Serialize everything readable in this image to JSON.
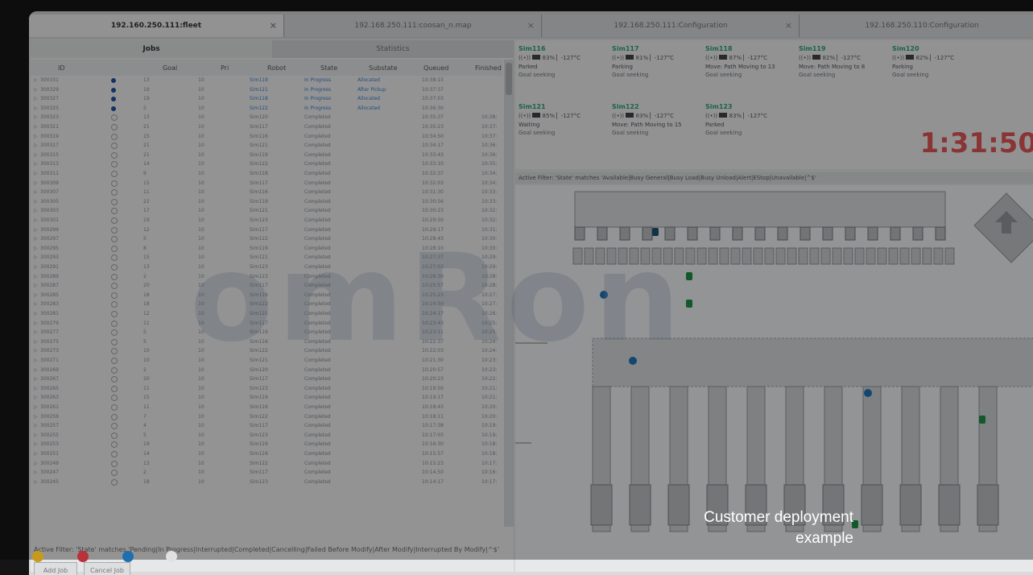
{
  "tabs": [
    {
      "label": "192.160.250.111:fleet",
      "active": true
    },
    {
      "label": "192.168.250.111:coosan_n.map",
      "active": false
    },
    {
      "label": "192.168.250.111:Configuration",
      "active": false
    },
    {
      "label": "192.168.250.110:Configuration",
      "active": false
    }
  ],
  "jobs_panel": {
    "tab_jobs": "Jobs",
    "tab_statistics": "Statistics",
    "columns": [
      "ID",
      "Goal",
      "Pri",
      "Robot",
      "State",
      "Substate",
      "Queued",
      "Finished"
    ],
    "rows": [
      {
        "id": "300331",
        "goal": "13",
        "pri": "10",
        "robot": "Sim119",
        "state": "In Progress",
        "substate": "Allocated",
        "queued": "10:38:15",
        "finished": ""
      },
      {
        "id": "300329",
        "goal": "19",
        "pri": "10",
        "robot": "Sim121",
        "state": "In Progress",
        "substate": "After Pickup",
        "queued": "10:37:37",
        "finished": ""
      },
      {
        "id": "300327",
        "goal": "19",
        "pri": "10",
        "robot": "Sim118",
        "state": "In Progress",
        "substate": "Allocated",
        "queued": "10:37:03",
        "finished": ""
      },
      {
        "id": "300325",
        "goal": "5",
        "pri": "10",
        "robot": "Sim122",
        "state": "In Progress",
        "substate": "Allocated",
        "queued": "10:36:30",
        "finished": ""
      },
      {
        "id": "300323",
        "goal": "13",
        "pri": "10",
        "robot": "Sim120",
        "state": "Completed",
        "substate": "",
        "queued": "10:35:37",
        "finished": "10:38:"
      },
      {
        "id": "300321",
        "goal": "21",
        "pri": "10",
        "robot": "Sim117",
        "state": "Completed",
        "substate": "",
        "queued": "10:35:23",
        "finished": "10:37:"
      },
      {
        "id": "300319",
        "goal": "15",
        "pri": "10",
        "robot": "Sim116",
        "state": "Completed",
        "substate": "",
        "queued": "10:34:50",
        "finished": "10:37:"
      },
      {
        "id": "300317",
        "goal": "21",
        "pri": "10",
        "robot": "Sim121",
        "state": "Completed",
        "substate": "",
        "queued": "10:34:17",
        "finished": "10:36:"
      },
      {
        "id": "300315",
        "goal": "21",
        "pri": "10",
        "robot": "Sim119",
        "state": "Completed",
        "substate": "",
        "queued": "10:33:43",
        "finished": "10:36:"
      },
      {
        "id": "300313",
        "goal": "14",
        "pri": "10",
        "robot": "Sim122",
        "state": "Completed",
        "substate": "",
        "queued": "10:33:10",
        "finished": "10:35:"
      },
      {
        "id": "300311",
        "goal": "9",
        "pri": "10",
        "robot": "Sim118",
        "state": "Completed",
        "substate": "",
        "queued": "10:32:37",
        "finished": "10:34:"
      },
      {
        "id": "300309",
        "goal": "15",
        "pri": "10",
        "robot": "Sim117",
        "state": "Completed",
        "substate": "",
        "queued": "10:32:03",
        "finished": "10:34:"
      },
      {
        "id": "300307",
        "goal": "11",
        "pri": "10",
        "robot": "Sim116",
        "state": "Completed",
        "substate": "",
        "queued": "10:31:30",
        "finished": "10:33:"
      },
      {
        "id": "300305",
        "goal": "22",
        "pri": "10",
        "robot": "Sim119",
        "state": "Completed",
        "substate": "",
        "queued": "10:30:56",
        "finished": "10:33:"
      },
      {
        "id": "300303",
        "goal": "17",
        "pri": "10",
        "robot": "Sim121",
        "state": "Completed",
        "substate": "",
        "queued": "10:30:23",
        "finished": "10:32:"
      },
      {
        "id": "300301",
        "goal": "19",
        "pri": "10",
        "robot": "Sim123",
        "state": "Completed",
        "substate": "",
        "queued": "10:29:50",
        "finished": "10:32:"
      },
      {
        "id": "300299",
        "goal": "12",
        "pri": "10",
        "robot": "Sim117",
        "state": "Completed",
        "substate": "",
        "queued": "10:29:17",
        "finished": "10:31:"
      },
      {
        "id": "300297",
        "goal": "5",
        "pri": "10",
        "robot": "Sim122",
        "state": "Completed",
        "substate": "",
        "queued": "10:28:43",
        "finished": "10:30:"
      },
      {
        "id": "300295",
        "goal": "8",
        "pri": "10",
        "robot": "Sim119",
        "state": "Completed",
        "substate": "",
        "queued": "10:28:10",
        "finished": "10:30:"
      },
      {
        "id": "300293",
        "goal": "15",
        "pri": "10",
        "robot": "Sim121",
        "state": "Completed",
        "substate": "",
        "queued": "10:27:37",
        "finished": "10:29:"
      },
      {
        "id": "300291",
        "goal": "13",
        "pri": "10",
        "robot": "Sim123",
        "state": "Completed",
        "substate": "",
        "queued": "10:27:03",
        "finished": "10:29:"
      },
      {
        "id": "300289",
        "goal": "2",
        "pri": "10",
        "robot": "Sim123",
        "state": "Completed",
        "substate": "",
        "queued": "10:26:30",
        "finished": "10:28:"
      },
      {
        "id": "300287",
        "goal": "20",
        "pri": "10",
        "robot": "Sim117",
        "state": "Completed",
        "substate": "",
        "queued": "10:25:57",
        "finished": "10:28:"
      },
      {
        "id": "300285",
        "goal": "18",
        "pri": "10",
        "robot": "Sim116",
        "state": "Completed",
        "substate": "",
        "queued": "10:25:23",
        "finished": "10:27:"
      },
      {
        "id": "300283",
        "goal": "18",
        "pri": "10",
        "robot": "Sim122",
        "state": "Completed",
        "substate": "",
        "queued": "10:24:50",
        "finished": "10:27:"
      },
      {
        "id": "300281",
        "goal": "12",
        "pri": "10",
        "robot": "Sim121",
        "state": "Completed",
        "substate": "",
        "queued": "10:24:17",
        "finished": "10:26:"
      },
      {
        "id": "300279",
        "goal": "11",
        "pri": "10",
        "robot": "Sim117",
        "state": "Completed",
        "substate": "",
        "queued": "10:23:43",
        "finished": "10:25:"
      },
      {
        "id": "300277",
        "goal": "5",
        "pri": "10",
        "robot": "Sim119",
        "state": "Completed",
        "substate": "",
        "queued": "10:23:11",
        "finished": "10:25:"
      },
      {
        "id": "300275",
        "goal": "5",
        "pri": "10",
        "robot": "Sim116",
        "state": "Completed",
        "substate": "",
        "queued": "10:22:37",
        "finished": "10:24:"
      },
      {
        "id": "300273",
        "goal": "10",
        "pri": "10",
        "robot": "Sim122",
        "state": "Completed",
        "substate": "",
        "queued": "10:22:03",
        "finished": "10:24:"
      },
      {
        "id": "300271",
        "goal": "10",
        "pri": "10",
        "robot": "Sim121",
        "state": "Completed",
        "substate": "",
        "queued": "10:21:30",
        "finished": "10:23:"
      },
      {
        "id": "300269",
        "goal": "2",
        "pri": "10",
        "robot": "Sim120",
        "state": "Completed",
        "substate": "",
        "queued": "10:20:57",
        "finished": "10:23:"
      },
      {
        "id": "300267",
        "goal": "20",
        "pri": "10",
        "robot": "Sim117",
        "state": "Completed",
        "substate": "",
        "queued": "10:20:23",
        "finished": "10:22:"
      },
      {
        "id": "300265",
        "goal": "11",
        "pri": "10",
        "robot": "Sim123",
        "state": "Completed",
        "substate": "",
        "queued": "10:19:50",
        "finished": "10:21:"
      },
      {
        "id": "300263",
        "goal": "15",
        "pri": "10",
        "robot": "Sim119",
        "state": "Completed",
        "substate": "",
        "queued": "10:19:17",
        "finished": "10:21:"
      },
      {
        "id": "300261",
        "goal": "11",
        "pri": "10",
        "robot": "Sim116",
        "state": "Completed",
        "substate": "",
        "queued": "10:18:43",
        "finished": "10:20:"
      },
      {
        "id": "300259",
        "goal": "7",
        "pri": "10",
        "robot": "Sim122",
        "state": "Completed",
        "substate": "",
        "queued": "10:18:11",
        "finished": "10:20:"
      },
      {
        "id": "300257",
        "goal": "4",
        "pri": "10",
        "robot": "Sim117",
        "state": "Completed",
        "substate": "",
        "queued": "10:17:38",
        "finished": "10:19:"
      },
      {
        "id": "300255",
        "goal": "5",
        "pri": "10",
        "robot": "Sim123",
        "state": "Completed",
        "substate": "",
        "queued": "10:17:03",
        "finished": "10:19:"
      },
      {
        "id": "300253",
        "goal": "19",
        "pri": "10",
        "robot": "Sim119",
        "state": "Completed",
        "substate": "",
        "queued": "10:16:30",
        "finished": "10:18:"
      },
      {
        "id": "300251",
        "goal": "14",
        "pri": "10",
        "robot": "Sim116",
        "state": "Completed",
        "substate": "",
        "queued": "10:15:57",
        "finished": "10:18:"
      },
      {
        "id": "300249",
        "goal": "13",
        "pri": "10",
        "robot": "Sim122",
        "state": "Completed",
        "substate": "",
        "queued": "10:15:23",
        "finished": "10:17:"
      },
      {
        "id": "300247",
        "goal": "2",
        "pri": "10",
        "robot": "Sim117",
        "state": "Completed",
        "substate": "",
        "queued": "10:14:50",
        "finished": "10:16:"
      },
      {
        "id": "300245",
        "goal": "18",
        "pri": "10",
        "robot": "Sim123",
        "state": "Completed",
        "substate": "",
        "queued": "10:14:17",
        "finished": "10:17:"
      }
    ],
    "filter_text": "Active Filter: 'State' matches 'Pending|In Progress|Interrupted|Completed|Cancelling|Failed Before Modify|After Modify|Interrupted By Modify|^$'",
    "add_job_label": "Add Job",
    "cancel_job_label": "Cancel Job"
  },
  "robots": [
    {
      "name": "Sim116",
      "battery": "83%",
      "temp": "-127°C",
      "status": "Parked",
      "sub": "Goal seeking"
    },
    {
      "name": "Sim117",
      "battery": "81%",
      "temp": "-127°C",
      "status": "Parking",
      "sub": "Goal seeking"
    },
    {
      "name": "Sim118",
      "battery": "87%",
      "temp": "-127°C",
      "status": "Move: Path  Moving to 13",
      "sub": "Goal seeking"
    },
    {
      "name": "Sim119",
      "battery": "82%",
      "temp": "-127°C",
      "status": "Move: Path  Moving to 8",
      "sub": "Goal seeking"
    },
    {
      "name": "Sim120",
      "battery": "82%",
      "temp": "-127°C",
      "status": "Parking",
      "sub": "Goal seeking"
    },
    {
      "name": "Sim121",
      "battery": "85%",
      "temp": "-127°C",
      "status": "Waiting",
      "sub": "Goal seeking"
    },
    {
      "name": "Sim122",
      "battery": "83%",
      "temp": "-127°C",
      "status": "Move: Path  Moving to 15",
      "sub": "Goal seeking"
    },
    {
      "name": "Sim123",
      "battery": "83%",
      "temp": "-127°C",
      "status": "Parked",
      "sub": "Goal seeking"
    }
  ],
  "clock": "1:31:50",
  "robot_filter_text": "Active Filter: 'State' matches 'Available|Busy General|Busy Load|Busy Unload|Alert|EStop|Unavailable|^$'",
  "watermark": "omRon",
  "caption": {
    "line1": "Customer deployment",
    "line2": "example"
  },
  "colors": {
    "accent_green": "#2b9c6f",
    "clock_red": "#d85454",
    "in_progress_blue": "#3b7bc4"
  }
}
